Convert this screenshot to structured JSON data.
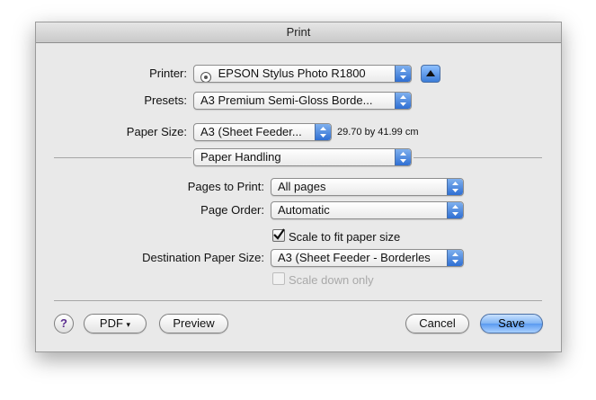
{
  "window": {
    "title": "Print"
  },
  "printer": {
    "label": "Printer:",
    "value": "EPSON Stylus Photo R1800",
    "status_icon": "printer-status-icon"
  },
  "presets": {
    "label": "Presets:",
    "value": "A3 Premium Semi-Gloss Borde..."
  },
  "paper_size": {
    "label": "Paper Size:",
    "value": "A3 (Sheet Feeder...",
    "dimensions": "29.70 by 41.99 cm"
  },
  "section": {
    "value": "Paper Handling"
  },
  "pages_to_print": {
    "label": "Pages to Print:",
    "value": "All pages"
  },
  "page_order": {
    "label": "Page Order:",
    "value": "Automatic"
  },
  "scale_to_fit": {
    "label": "Scale to fit paper size",
    "checked": true
  },
  "destination": {
    "label": "Destination Paper Size:",
    "value": "A3 (Sheet Feeder - Borderles"
  },
  "scale_down": {
    "label": "Scale down only",
    "checked": false,
    "enabled": false
  },
  "buttons": {
    "help": "?",
    "pdf": "PDF",
    "pdf_arrow": "▾",
    "preview": "Preview",
    "cancel": "Cancel",
    "print": "Save"
  },
  "colors": {
    "accent": "#3b7cd8",
    "help_glyph": "#5b2d8f"
  }
}
